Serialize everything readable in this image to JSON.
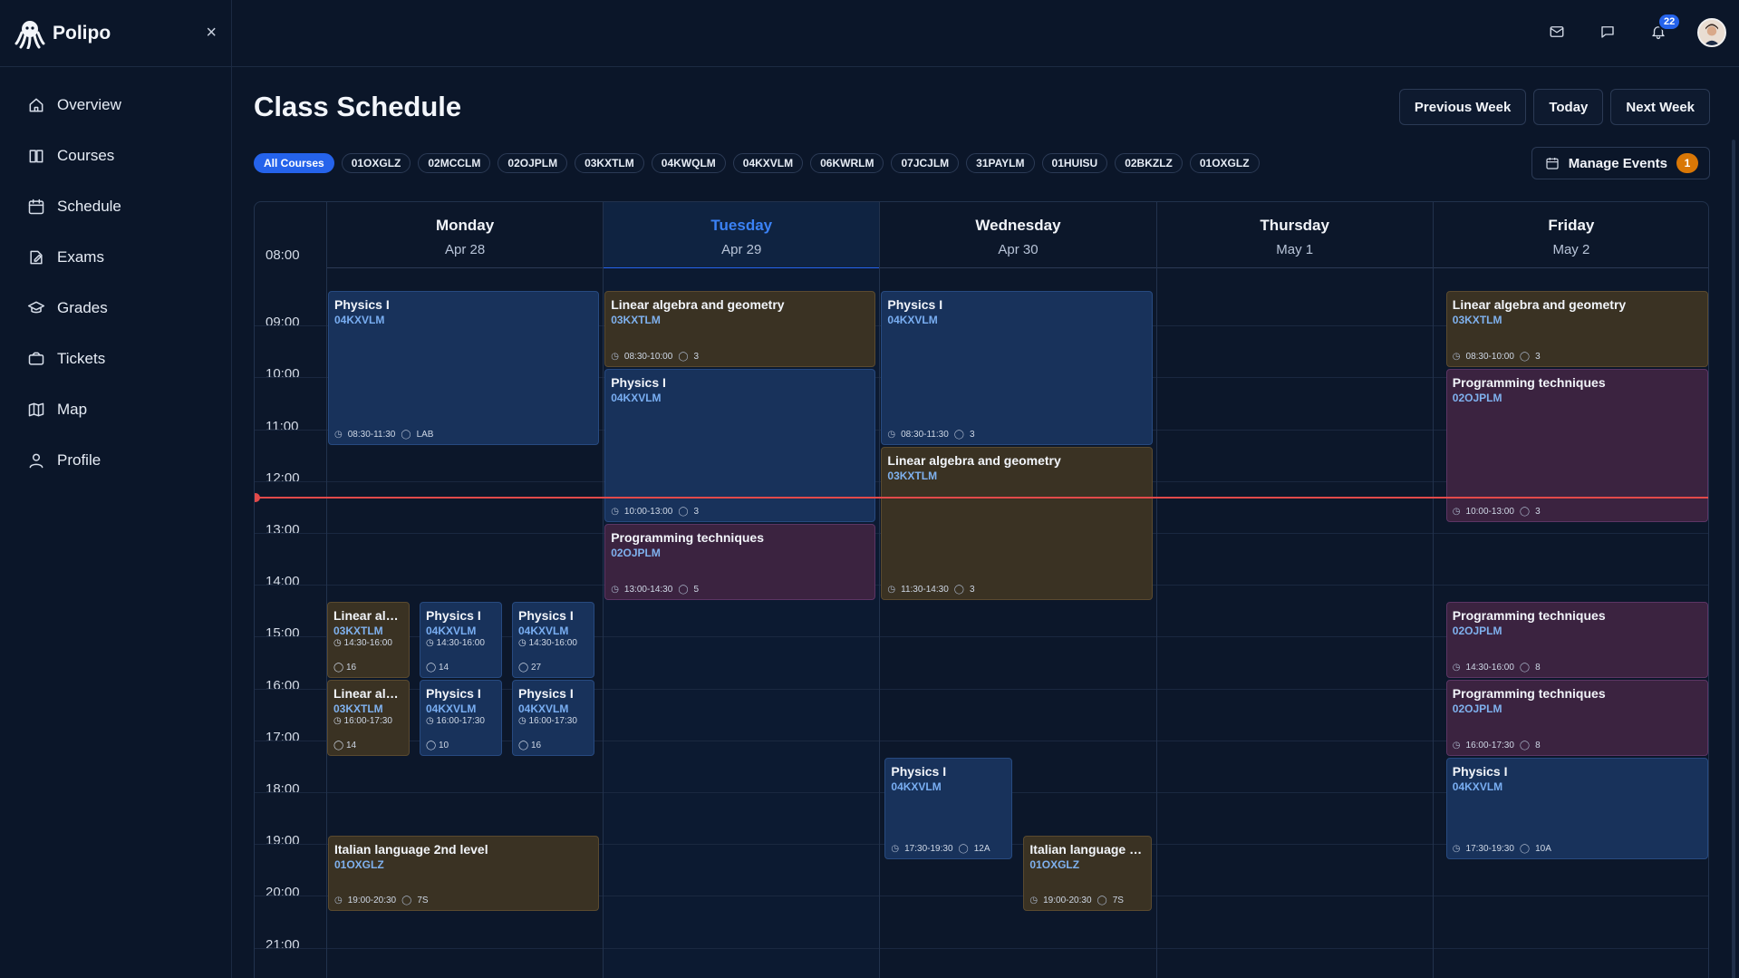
{
  "app": {
    "name": "Polipo",
    "close_icon": "×"
  },
  "nav": [
    {
      "label": "Overview",
      "icon": "home-icon"
    },
    {
      "label": "Courses",
      "icon": "book-icon"
    },
    {
      "label": "Schedule",
      "icon": "calendar-icon"
    },
    {
      "label": "Exams",
      "icon": "edit-icon"
    },
    {
      "label": "Grades",
      "icon": "graduation-cap-icon"
    },
    {
      "label": "Tickets",
      "icon": "ticket-icon"
    },
    {
      "label": "Map",
      "icon": "map-icon"
    },
    {
      "label": "Profile",
      "icon": "user-icon"
    }
  ],
  "topbar": {
    "notification_count": "22"
  },
  "page": {
    "title": "Class Schedule",
    "prev_week": "Previous Week",
    "today": "Today",
    "next_week": "Next Week",
    "manage_events": "Manage Events",
    "manage_count": "1"
  },
  "filters": [
    "All Courses",
    "01OXGLZ",
    "02MCCLM",
    "02OJPLM",
    "03KXTLM",
    "04KWQLM",
    "04KXVLM",
    "06KWRLM",
    "07JCJLM",
    "31PAYLM",
    "01HUISU",
    "02BKZLZ",
    "01OXGLZ"
  ],
  "days": [
    {
      "name": "Monday",
      "date": "Apr 28"
    },
    {
      "name": "Tuesday",
      "date": "Apr 29",
      "today": true
    },
    {
      "name": "Wednesday",
      "date": "Apr 30"
    },
    {
      "name": "Thursday",
      "date": "May 1"
    },
    {
      "name": "Friday",
      "date": "May 2"
    }
  ],
  "hours": [
    "08:00",
    "09:00",
    "10:00",
    "11:00",
    "12:00",
    "13:00",
    "14:00",
    "15:00",
    "16:00",
    "17:00",
    "18:00",
    "19:00",
    "20:00",
    "21:00"
  ],
  "events": [
    {
      "day": 0,
      "start": 8.5,
      "end": 11.5,
      "lane": 0,
      "lanes": 1,
      "title": "Physics I",
      "code": "04KXVLM",
      "time": "08:30-11:30",
      "room": "LAB",
      "color": "blue"
    },
    {
      "day": 0,
      "start": 14.5,
      "end": 16.0,
      "lane": 0,
      "lanes": 3,
      "title": "Linear alg...",
      "code": "03KXTLM",
      "time": "14:30-16:00",
      "room": "16",
      "color": "brown",
      "compact": true
    },
    {
      "day": 0,
      "start": 14.5,
      "end": 16.0,
      "lane": 1,
      "lanes": 3,
      "title": "Physics I",
      "code": "04KXVLM",
      "time": "14:30-16:00",
      "room": "14",
      "color": "blue",
      "compact": true
    },
    {
      "day": 0,
      "start": 14.5,
      "end": 16.0,
      "lane": 2,
      "lanes": 3,
      "title": "Physics I",
      "code": "04KXVLM",
      "time": "14:30-16:00",
      "room": "27",
      "color": "blue",
      "compact": true
    },
    {
      "day": 0,
      "start": 16.0,
      "end": 17.5,
      "lane": 0,
      "lanes": 3,
      "title": "Linear alg...",
      "code": "03KXTLM",
      "time": "16:00-17:30",
      "room": "14",
      "color": "brown",
      "compact": true
    },
    {
      "day": 0,
      "start": 16.0,
      "end": 17.5,
      "lane": 1,
      "lanes": 3,
      "title": "Physics I",
      "code": "04KXVLM",
      "time": "16:00-17:30",
      "room": "10",
      "color": "blue",
      "compact": true
    },
    {
      "day": 0,
      "start": 16.0,
      "end": 17.5,
      "lane": 2,
      "lanes": 3,
      "title": "Physics I",
      "code": "04KXVLM",
      "time": "16:00-17:30",
      "room": "16",
      "color": "blue",
      "compact": true
    },
    {
      "day": 0,
      "start": 19.0,
      "end": 20.5,
      "lane": 0,
      "lanes": 1,
      "title": "Italian language 2nd level",
      "code": "01OXGLZ",
      "time": "19:00-20:30",
      "room": "7S",
      "color": "brown"
    },
    {
      "day": 1,
      "start": 8.5,
      "end": 10.0,
      "lane": 0,
      "lanes": 1,
      "title": "Linear algebra and geometry",
      "code": "03KXTLM",
      "time": "08:30-10:00",
      "room": "3",
      "color": "brown"
    },
    {
      "day": 1,
      "start": 10.0,
      "end": 13.0,
      "lane": 0,
      "lanes": 1,
      "title": "Physics I",
      "code": "04KXVLM",
      "time": "10:00-13:00",
      "room": "3",
      "color": "blue"
    },
    {
      "day": 1,
      "start": 13.0,
      "end": 14.5,
      "lane": 0,
      "lanes": 1,
      "title": "Programming techniques",
      "code": "02OJPLM",
      "time": "13:00-14:30",
      "room": "5",
      "color": "purple"
    },
    {
      "day": 2,
      "start": 8.5,
      "end": 11.5,
      "lane": 0,
      "lanes": 1,
      "title": "Physics I",
      "code": "04KXVLM",
      "time": "08:30-11:30",
      "room": "3",
      "color": "blue"
    },
    {
      "day": 2,
      "start": 11.5,
      "end": 14.5,
      "lane": 0,
      "lanes": 1,
      "title": "Linear algebra and geometry",
      "code": "03KXTLM",
      "time": "11:30-14:30",
      "room": "3",
      "color": "brown"
    },
    {
      "day": 2,
      "start": 17.5,
      "end": 19.5,
      "lane": 0,
      "lanes": 2,
      "title": "Physics I",
      "code": "04KXVLM",
      "time": "17:30-19:30",
      "room": "12A",
      "color": "blue"
    },
    {
      "day": 2,
      "start": 19.0,
      "end": 20.5,
      "lane": 1,
      "lanes": 2,
      "title": "Italian language 2...",
      "code": "01OXGLZ",
      "time": "19:00-20:30",
      "room": "7S",
      "color": "brown"
    },
    {
      "day": 4,
      "start": 8.5,
      "end": 10.0,
      "lane": 0,
      "lanes": 1,
      "title": "Linear algebra and geometry",
      "code": "03KXTLM",
      "time": "08:30-10:00",
      "room": "3",
      "color": "brown",
      "indent": true
    },
    {
      "day": 4,
      "start": 10.0,
      "end": 13.0,
      "lane": 0,
      "lanes": 1,
      "title": "Programming techniques",
      "code": "02OJPLM",
      "time": "10:00-13:00",
      "room": "3",
      "color": "purple",
      "indent": true
    },
    {
      "day": 4,
      "start": 14.5,
      "end": 16.0,
      "lane": 0,
      "lanes": 1,
      "title": "Programming techniques",
      "code": "02OJPLM",
      "time": "14:30-16:00",
      "room": "8",
      "color": "purple",
      "indent": true
    },
    {
      "day": 4,
      "start": 16.0,
      "end": 17.5,
      "lane": 0,
      "lanes": 1,
      "title": "Programming techniques",
      "code": "02OJPLM",
      "time": "16:00-17:30",
      "room": "8",
      "color": "purple",
      "indent": true
    },
    {
      "day": 4,
      "start": 17.5,
      "end": 19.5,
      "lane": 0,
      "lanes": 1,
      "title": "Physics I",
      "code": "04KXVLM",
      "time": "17:30-19:30",
      "room": "10A",
      "color": "blue",
      "indent": true
    }
  ],
  "now_time": 12.5
}
